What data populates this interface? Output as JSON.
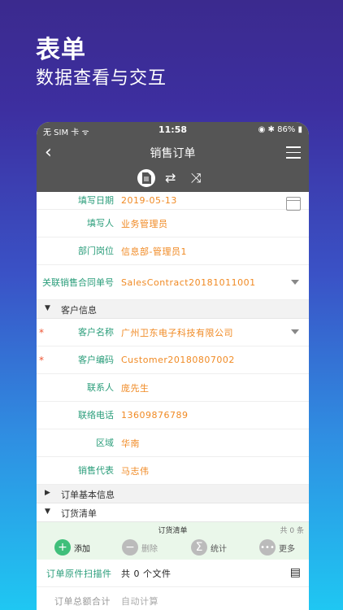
{
  "promo": {
    "title": "表单",
    "subtitle": "数据查看与交互"
  },
  "status": {
    "left": "无 SIM 卡 ᯤ",
    "time": "11:58",
    "right": "◉ ✱ 86% ▮"
  },
  "nav": {
    "title": "销售订单",
    "back": "‹"
  },
  "tabs": {
    "sync": "⇄",
    "shuffle": "⤨"
  },
  "fields": [
    {
      "label": "填写日期",
      "value": "2019-05-13"
    },
    {
      "label": "填写人",
      "value": "业务管理员"
    },
    {
      "label": "部门岗位",
      "value": "信息部-管理员1"
    },
    {
      "label": "关联销售合同单号",
      "value": "SalesContract20181011001"
    }
  ],
  "sections": {
    "customer": "客户信息",
    "order_basic": "订单基本信息",
    "order_list": "订货清单"
  },
  "customer_fields": [
    {
      "label": "客户名称",
      "value": "广州卫东电子科技有限公司"
    },
    {
      "label": "客户编码",
      "value": "Customer20180807002"
    },
    {
      "label": "联系人",
      "value": "庞先生"
    },
    {
      "label": "联络电话",
      "value": "13609876789"
    },
    {
      "label": "区域",
      "value": "华南"
    },
    {
      "label": "销售代表",
      "value": "马志伟"
    }
  ],
  "order_list": {
    "title": "订货清单",
    "count": "共 0 条"
  },
  "actions": {
    "add": "添加",
    "delete": "删除",
    "stats": "统计",
    "more": "更多"
  },
  "scan": {
    "label": "订单原件扫描件",
    "value": "共 0 个文件"
  },
  "total": {
    "label": "订单总额合计",
    "value": "自动计算"
  },
  "triangles": {
    "open": "▼",
    "closed": "▶"
  }
}
